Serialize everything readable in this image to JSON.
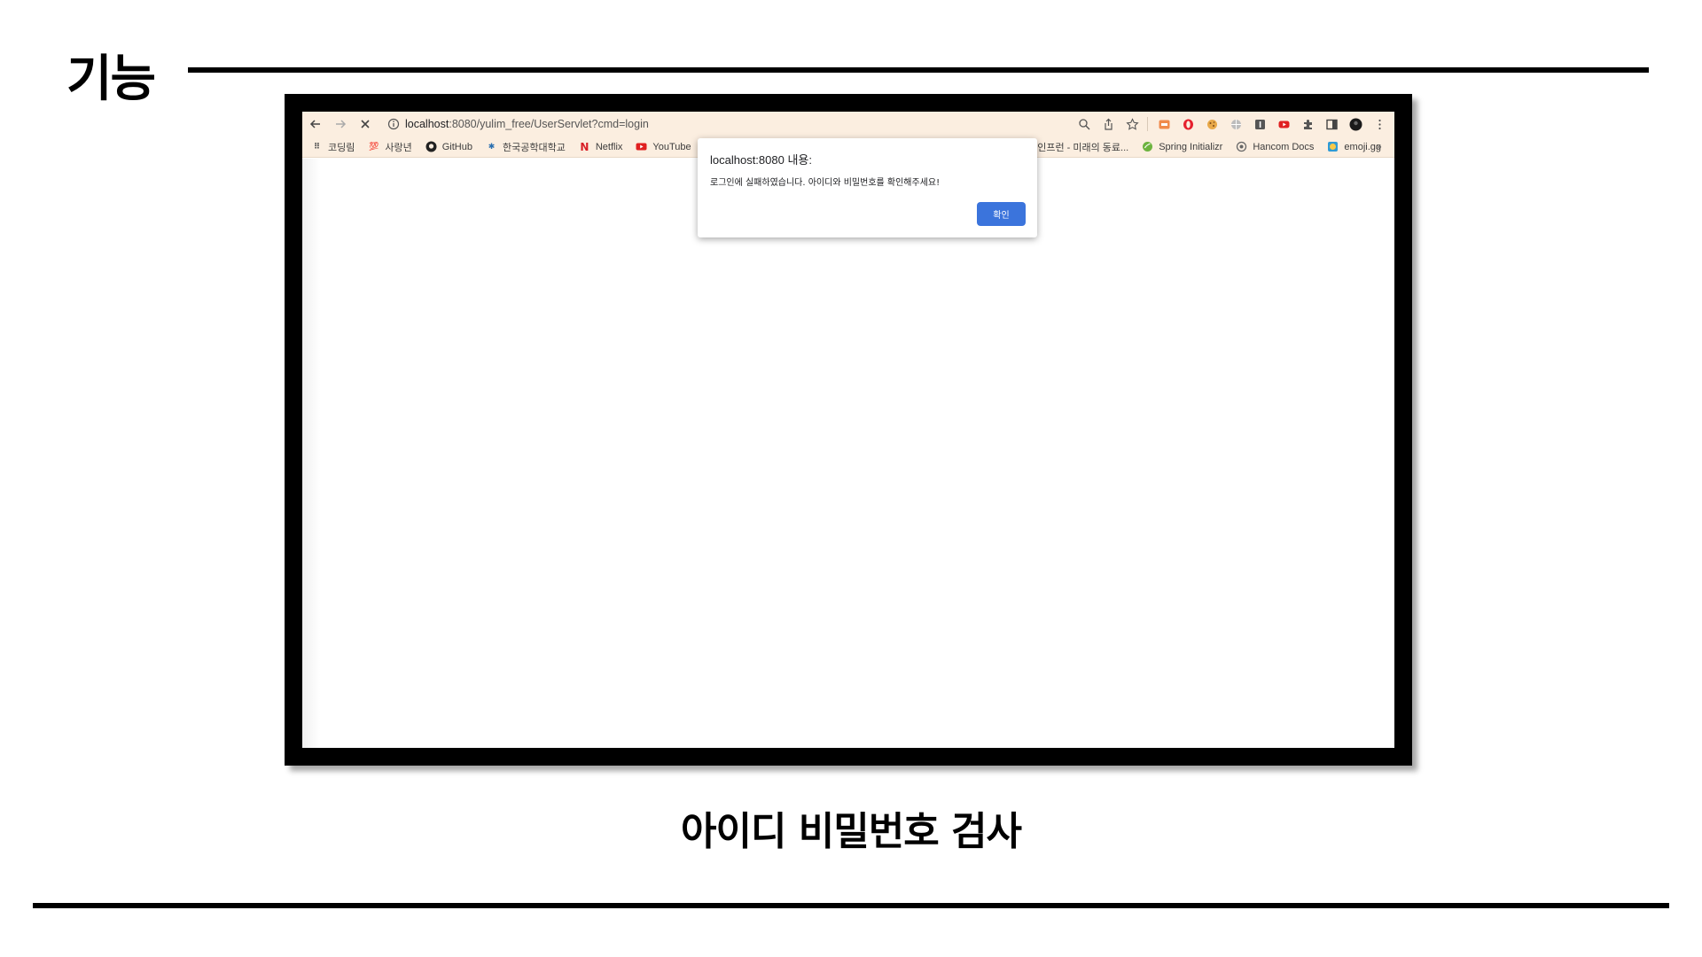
{
  "slide": {
    "title": "기능",
    "caption": "아이디 비밀번호 검사"
  },
  "browser": {
    "url_host": "localhost",
    "url_rest": ":8080/yulim_free/UserServlet?cmd=login",
    "bookmarks": [
      {
        "label": "코딩림",
        "icon": "dots-icon"
      },
      {
        "label": "사랑년",
        "icon": "hundred-emoji-icon"
      },
      {
        "label": "GitHub",
        "icon": "github-icon"
      },
      {
        "label": "한국공학대학교",
        "icon": "university-icon"
      },
      {
        "label": "Netflix",
        "icon": "netflix-icon"
      },
      {
        "label": "YouTube",
        "icon": "youtube-icon"
      },
      {
        "label": "인프런 - 미래의 동료...",
        "icon": "inflearn-icon"
      },
      {
        "label": "Spring Initializr",
        "icon": "spring-icon"
      },
      {
        "label": "Hancom Docs",
        "icon": "hancom-icon"
      },
      {
        "label": "emoji.gg",
        "icon": "emoji-icon"
      }
    ],
    "bookmarks_more": "»"
  },
  "dialog": {
    "title": "localhost:8080 내용:",
    "message": "로그인에 실패하였습니다. 아이디와 비밀번호를 확인해주세요!",
    "ok_label": "확인"
  },
  "colors": {
    "toolbar_bg": "#fbeee0",
    "ok_button": "#3b74dc",
    "frame": "#000000"
  }
}
